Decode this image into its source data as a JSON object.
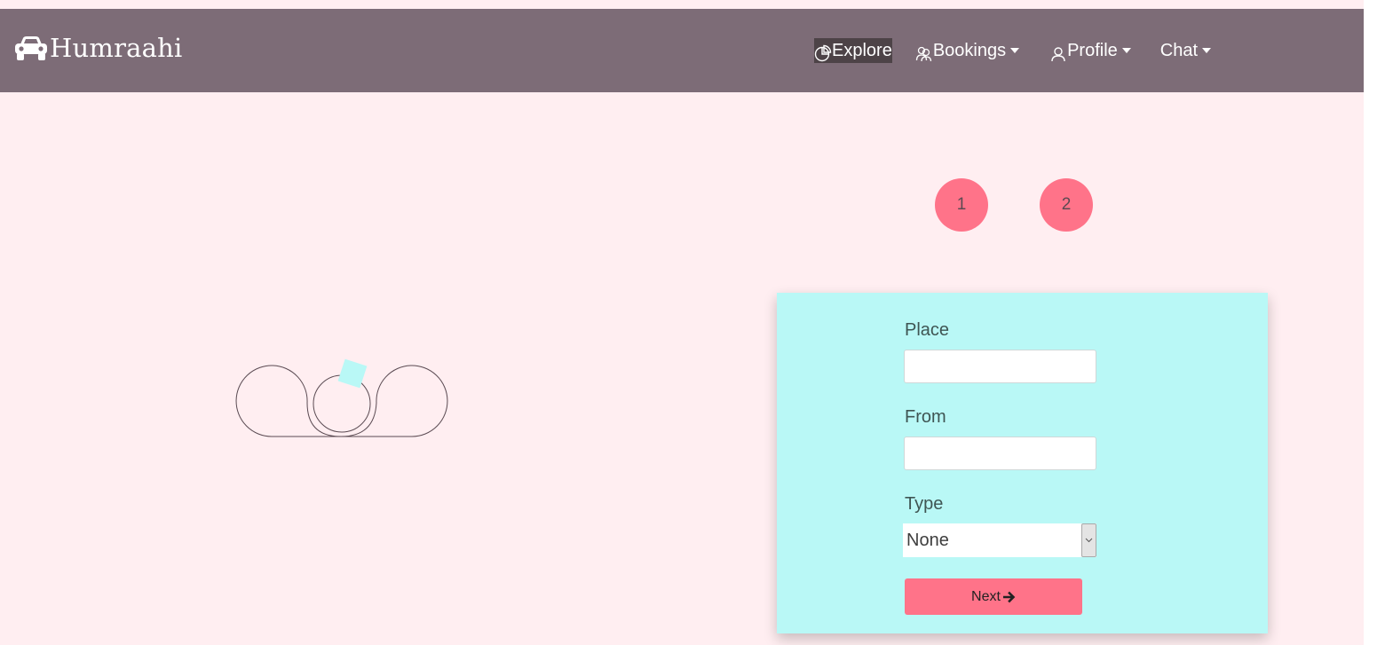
{
  "brand": {
    "name": "Humraahi",
    "icon": "car-icon"
  },
  "nav": {
    "items": [
      {
        "label": "Explore",
        "icon": "pie-chart-icon",
        "active": true,
        "dropdown": false
      },
      {
        "label": "Bookings",
        "icon": "users-icon",
        "active": false,
        "dropdown": true
      },
      {
        "label": "Profile",
        "icon": "user-icon",
        "active": false,
        "dropdown": true
      },
      {
        "label": "Chat",
        "icon": "",
        "active": false,
        "dropdown": true
      }
    ]
  },
  "steps": [
    "1",
    "2"
  ],
  "form": {
    "place_label": "Place",
    "place_value": "",
    "from_label": "From",
    "from_value": "",
    "type_label": "Type",
    "type_value": "None",
    "next_label": "Next"
  },
  "colors": {
    "navbar": "#7d6c77",
    "background": "#ffeef1",
    "accent": "#ff7389",
    "card": "#b9f8f6"
  }
}
